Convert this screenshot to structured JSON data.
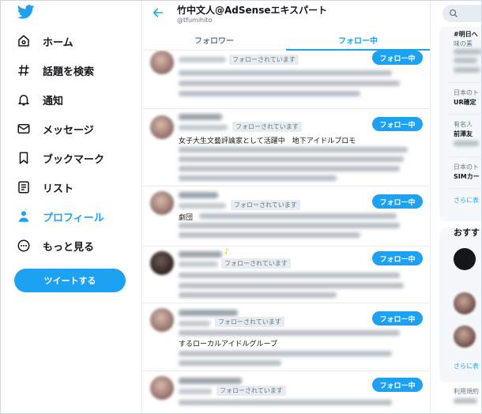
{
  "nav": {
    "items": [
      {
        "label": "ホーム",
        "icon": "home-icon"
      },
      {
        "label": "話題を検索",
        "icon": "hashtag-icon"
      },
      {
        "label": "通知",
        "icon": "bell-icon"
      },
      {
        "label": "メッセージ",
        "icon": "envelope-icon"
      },
      {
        "label": "ブックマーク",
        "icon": "bookmark-icon"
      },
      {
        "label": "リスト",
        "icon": "list-icon"
      },
      {
        "label": "プロフィール",
        "icon": "person-icon"
      },
      {
        "label": "もっと見る",
        "icon": "more-icon"
      }
    ],
    "active_index": 6,
    "tweet_button": "ツイートする"
  },
  "profile": {
    "title": "竹中文人@AdSenseエキスパート",
    "handle": "@tfumihito"
  },
  "tabs": [
    "フォロワー",
    "フォロー中"
  ],
  "active_tab": 1,
  "users": [
    {
      "badge": "フォローされています",
      "button": "フォロー中",
      "bio": ""
    },
    {
      "badge": "フォローされています",
      "button": "フォロー中",
      "bio": "女子大生文藝評論家として活躍中　地下アイドルプロモ"
    },
    {
      "badge": "フォローされています",
      "button": "フォロー中",
      "bio": "劇団"
    },
    {
      "badge": "フォローされています",
      "button": "フォロー中",
      "bio": ""
    },
    {
      "badge": "フォローされています",
      "button": "フォロー中",
      "bio": "するローカルアイドルグループ"
    },
    {
      "badge": "フォローされています",
      "button": "フォロー中",
      "bio": ""
    }
  ],
  "right": {
    "trends": [
      {
        "title": "#明日へ",
        "line": "味の素"
      },
      {
        "title": "UR確定",
        "muted": "日本のト"
      },
      {
        "title": "前澤友",
        "muted": "有名人"
      },
      {
        "title": "SIMカー",
        "muted": "日本のト"
      }
    ],
    "more1": "さらに表",
    "recommend_title": "おすす",
    "more2": "さらに表",
    "footer": "利用規約"
  },
  "colors": {
    "accent": "#1da1f2",
    "border": "#e6ecf0",
    "muted": "#657786"
  }
}
